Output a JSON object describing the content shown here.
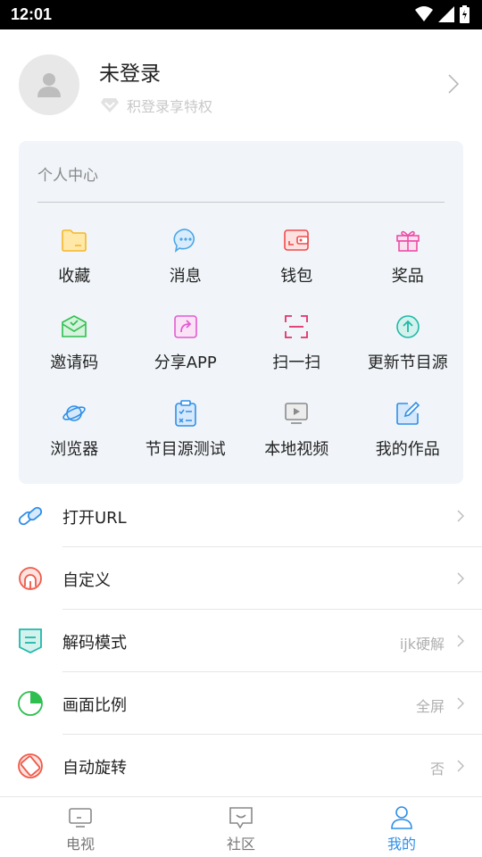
{
  "status_bar": {
    "time": "12:01",
    "icons": [
      "wifi-icon",
      "signal-icon",
      "battery-icon"
    ]
  },
  "profile": {
    "avatar_icon": "person-icon",
    "name": "未登录",
    "subtitle": "积登录享特权",
    "badge_icon": "diamond-icon"
  },
  "personal_center": {
    "title": "个人中心",
    "items": [
      {
        "label": "收藏",
        "icon": "folder-icon"
      },
      {
        "label": "消息",
        "icon": "message-icon"
      },
      {
        "label": "钱包",
        "icon": "wallet-icon"
      },
      {
        "label": "奖品",
        "icon": "gift-icon"
      },
      {
        "label": "邀请码",
        "icon": "invite-mail-icon"
      },
      {
        "label": "分享APP",
        "icon": "share-icon"
      },
      {
        "label": "扫一扫",
        "icon": "scan-icon"
      },
      {
        "label": "更新节目源",
        "icon": "upload-circle-icon"
      },
      {
        "label": "浏览器",
        "icon": "planet-icon"
      },
      {
        "label": "节目源测试",
        "icon": "clipboard-check-icon"
      },
      {
        "label": "本地视频",
        "icon": "video-icon"
      },
      {
        "label": "我的作品",
        "icon": "edit-icon"
      }
    ]
  },
  "settings": [
    {
      "label": "打开URL",
      "value": "",
      "icon": "link-icon"
    },
    {
      "label": "自定义",
      "value": "",
      "icon": "custom-icon"
    },
    {
      "label": "解码模式",
      "value": "ijk硬解",
      "icon": "decode-icon"
    },
    {
      "label": "画面比例",
      "value": "全屏",
      "icon": "pie-chart-icon"
    },
    {
      "label": "自动旋转",
      "value": "否",
      "icon": "rotate-icon"
    }
  ],
  "bottom_nav": [
    {
      "label": "电视",
      "icon": "tv-icon",
      "active": false
    },
    {
      "label": "社区",
      "icon": "community-icon",
      "active": false
    },
    {
      "label": "我的",
      "icon": "user-icon",
      "active": true
    }
  ],
  "colors": {
    "accent": "#2f8fe8",
    "card_bg": "#f1f5f9",
    "folder": "#f5b72a",
    "message": "#4aa6e8",
    "wallet": "#ef4b4b",
    "gift": "#ec4fa8",
    "invite": "#2fbf4f",
    "share": "#e35bd0",
    "scan": "#e0326a",
    "update": "#1fb9a7",
    "planet": "#2f8fe8",
    "clipboard": "#2f8fe8",
    "video": "#8a8a8a",
    "edit": "#2f8fe8",
    "link": "#2f8fe8",
    "custom": "#ef5a4a",
    "decode": "#1fb9a7",
    "ratio": "#2fbf4f",
    "rotate": "#ef5a4a"
  }
}
